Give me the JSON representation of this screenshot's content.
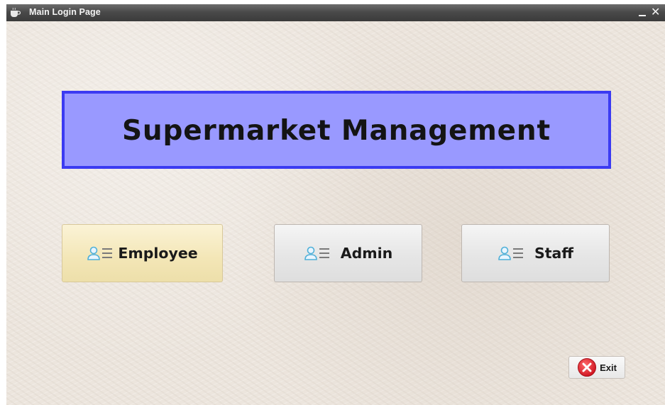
{
  "window": {
    "title": "Main Login Page",
    "icon": "coffee-cup-icon",
    "controls": {
      "minimize": "minimize-icon",
      "close": "close-icon",
      "close_glyph": "✕"
    }
  },
  "banner": {
    "title": "Supermarket Management",
    "background_color": "#9999ff",
    "border_color": "#3b3bf2"
  },
  "roles": [
    {
      "label": "Employee",
      "icon": "user-list-icon",
      "state": "hovered"
    },
    {
      "label": "Admin",
      "icon": "user-list-icon",
      "state": "normal"
    },
    {
      "label": "Staff",
      "icon": "user-list-icon",
      "state": "normal"
    }
  ],
  "exit": {
    "label": "Exit",
    "icon": "close-circle-icon",
    "icon_color": "#e0232e"
  }
}
